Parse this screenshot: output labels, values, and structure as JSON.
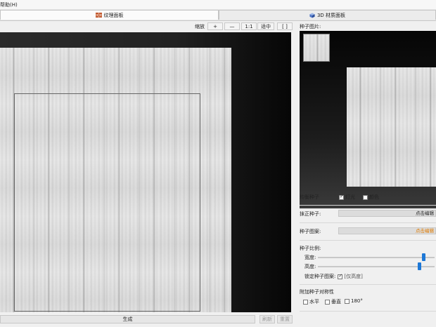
{
  "menu": {
    "help_label": "帮助(H)"
  },
  "tabs": [
    {
      "label": "纹理面板",
      "icon": "brick-icon",
      "active": true
    },
    {
      "label": "3D 材质面板",
      "icon": "cube-icon",
      "active": false
    }
  ],
  "toolbar": {
    "zoom_label": "缩放",
    "zoom_in": "+",
    "zoom_out": "—",
    "one_to_one": "1:1",
    "fit": "适中",
    "frame": "[  ]"
  },
  "bottom": {
    "generate": "生成",
    "refresh": "刷新",
    "reset": "重置"
  },
  "seed_panel": {
    "seed_image_label": "种子图片:",
    "balance_seed_label": "均衡种子",
    "lighting_label": "灯光",
    "lighting_checked": true,
    "color_label": "颜色",
    "color_checked": false,
    "erase_seed_label": "抹正种子:",
    "erase_edit": "点击编辑",
    "seed_pattern_label": "种子图案:",
    "pattern_edit": "点击编辑",
    "seed_scale_label": "种子比例:",
    "width_label": "宽度:",
    "height_label": "高度:",
    "lock_label": "锁定种子图案:",
    "lock_checked": true,
    "lock_value": "[仅高度]",
    "width_level": 0.92,
    "height_level": 0.88,
    "extra_symmetry_label": "附加种子对称性",
    "horizontal_label": "水平",
    "vertical_label": "垂直",
    "rotate_label": "180°",
    "accent": "#e07b00",
    "slider_color": "#1e78d6"
  }
}
